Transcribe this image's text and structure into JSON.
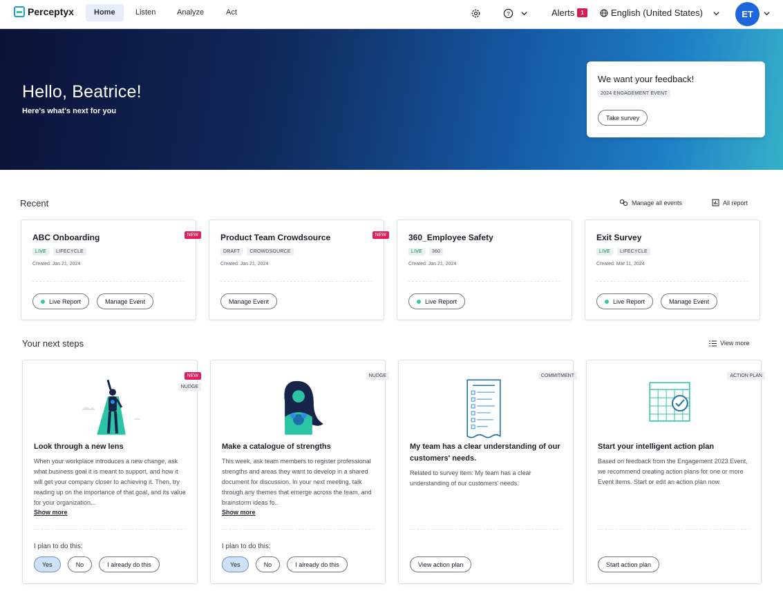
{
  "nav": {
    "logo": "Perceptyx",
    "tabs": [
      {
        "label": "Home",
        "active": true
      },
      {
        "label": "Listen"
      },
      {
        "label": "Analyze"
      },
      {
        "label": "Act"
      }
    ],
    "alerts_label": "Alerts",
    "alerts_count": "1",
    "language": "English (United States)",
    "avatar_initials": "ET"
  },
  "hero": {
    "greeting": "Hello, Beatrice!",
    "subtitle": "Here's what's next for you",
    "feedback": {
      "title": "We want your feedback!",
      "tag": "2024 ENGAGEMENT EVENT",
      "button": "Take survey"
    }
  },
  "recent": {
    "heading": "Recent",
    "manage_all": "Manage all events",
    "all_report": "All report",
    "cards": [
      {
        "title": "ABC Onboarding",
        "new": "NEW",
        "status": "LIVE",
        "type": "LIFECYCLE",
        "created": "Created: Jan 21, 2024",
        "live_report": "Live Report",
        "manage": "Manage Event"
      },
      {
        "title": "Product Team Crowdsource",
        "new": "NEW",
        "status": "DRAFT",
        "type": "CROWDSOURCE",
        "created": "Created: Jan 21, 2024",
        "manage": "Manage Event"
      },
      {
        "title": "360_Employee Safety",
        "status": "LIVE",
        "type": "360",
        "created": "Created: Jan 21, 2024",
        "live_report": "Live Report"
      },
      {
        "title": "Exit Survey",
        "status": "LIVE",
        "type": "LIFECYCLE",
        "created": "Created: Mar 11, 2024",
        "live_report": "Live Report",
        "manage": "Manage Event"
      }
    ]
  },
  "next_steps": {
    "heading": "Your next steps",
    "view_more": "View more",
    "plan_label": "I plan to do this:",
    "yes": "Yes",
    "no": "No",
    "already": "I already do this",
    "show_more": "Show more",
    "cards": [
      {
        "new": "NEW",
        "kind": "NUDGE",
        "title": "Look through a new lens",
        "body": "When your workplace introduces a new change, ask what business goal it is meant to support, and how it will get your company closer to achieving it. Then, try reading up on the importance of that goal, and its value for your organization..."
      },
      {
        "kind": "NUDGE",
        "title": "Make a catalogue of strengths",
        "body": "This week, ask team members to register professional strengths and areas they want to develop in a shared document for discussion. In your next meeting, talk through any themes that emerge across the team, and brainstorm ideas fo.."
      },
      {
        "kind": "COMMITMENT",
        "title": "My team has a clear understanding of our customers' needs.",
        "body": "Related to survey item: My team has a clear understanding of our customers' needs.",
        "button": "View action plan"
      },
      {
        "kind": "ACTION PLAN",
        "title": "Start your intelligent action plan",
        "body": "Based on feedback from the Engagement 2023 Event, we recommend creating action plans for one or more Event items. Start or edit an action plan now.",
        "button": "Start action plan"
      }
    ]
  },
  "colors": {
    "accent": "#1d66dc",
    "new_badge": "#e11d5a",
    "live_dot": "#2ecf9a",
    "illustration": "#2cc4a5"
  }
}
